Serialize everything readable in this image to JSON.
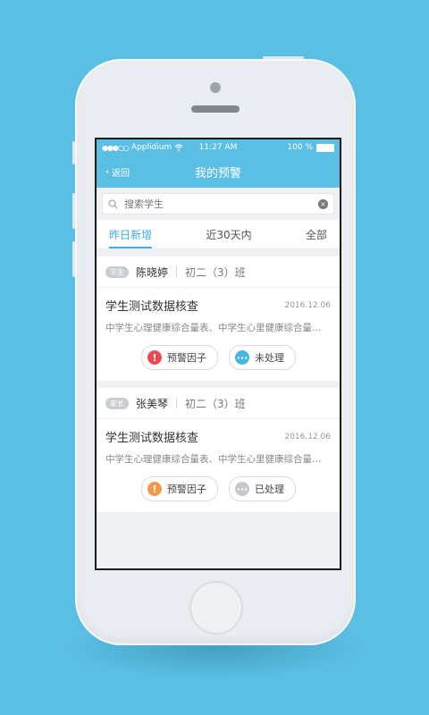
{
  "status": {
    "carrier": "Applidium",
    "time": "11:27 AM",
    "battery": "100 %"
  },
  "nav": {
    "back_label": "返回",
    "title": "我的预警"
  },
  "search": {
    "placeholder": "搜索学生"
  },
  "tabs": [
    {
      "label": "昨日新增",
      "active": true
    },
    {
      "label": "近30天内",
      "active": false
    },
    {
      "label": "全部",
      "active": false
    }
  ],
  "cards": [
    {
      "role": "学生",
      "name": "陈晓婷",
      "class": "初二（3）班",
      "title": "学生测试数据核查",
      "date": "2016.12.06",
      "desc": "中学生心理健康综合量表、中学生心里健康综合量…",
      "warning_label": "预警因子",
      "warning_color": "#e94b52",
      "status_label": "未处理",
      "status_color": "#45b8e2"
    },
    {
      "role": "家长",
      "name": "张美琴",
      "class": "初二（3）班",
      "title": "学生测试数据核查",
      "date": "2016.12.06",
      "desc": "中学生心理健康综合量表、中学生心里健康综合量…",
      "warning_label": "预警因子",
      "warning_color": "#f39a4a",
      "status_label": "已处理",
      "status_color": "#c5c9ce"
    }
  ],
  "colors": {
    "accent": "#3ab0e0",
    "background": "#5bbfe3"
  }
}
